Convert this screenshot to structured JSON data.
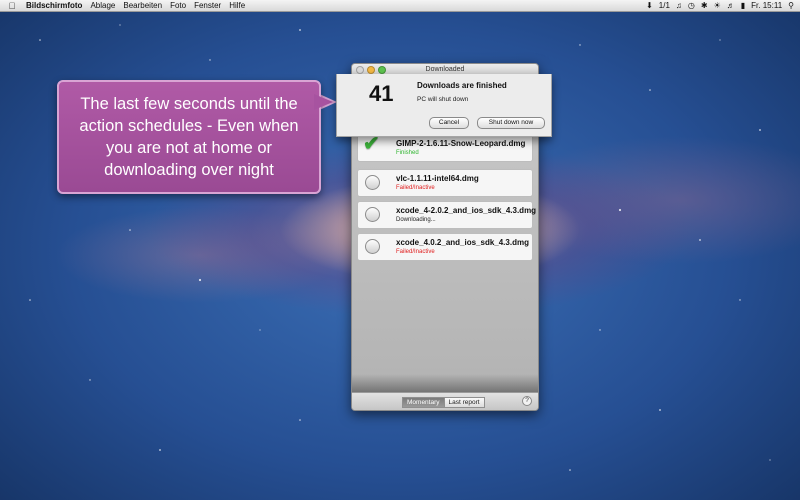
{
  "menubar": {
    "app_name": "Bildschirmfoto",
    "menus": [
      "Ablage",
      "Bearbeiten",
      "Foto",
      "Fenster",
      "Hilfe"
    ],
    "status": {
      "download_count": "1/1",
      "clock": "Fr. 15:11"
    }
  },
  "callout": {
    "text": "The last few seconds until the action schedules - Even when you are not at home or downloading over night"
  },
  "window": {
    "title": "Downloaded",
    "items": [
      {
        "name": "GIMP-2-1.6.11-Snow-Leopard.dmg",
        "status": "Finished",
        "status_color": "#2fb52f",
        "done": true
      },
      {
        "name": "vlc-1.1.11-intel64.dmg",
        "status": "Failed/Inactive",
        "status_color": "#e02020",
        "done": false
      },
      {
        "name": "xcode_4-2.0.2_and_ios_sdk_4.3.dmg",
        "status": "Downloading...",
        "status_color": "#222222",
        "done": false
      },
      {
        "name": "xcode_4.0.2_and_ios_sdk_4.3.dmg",
        "status": "Failed/Inactive",
        "status_color": "#e02020",
        "done": false
      }
    ],
    "tabs": [
      "Momentary",
      "Last report"
    ],
    "help_label": "?"
  },
  "dialog": {
    "countdown": "41",
    "title": "Downloads are finished",
    "message": "PC will shut down",
    "cancel_label": "Cancel",
    "confirm_label": "Shut down now"
  },
  "colors": {
    "callout_bg": "#a753a0",
    "finished": "#2fb52f",
    "failed": "#e02020"
  }
}
